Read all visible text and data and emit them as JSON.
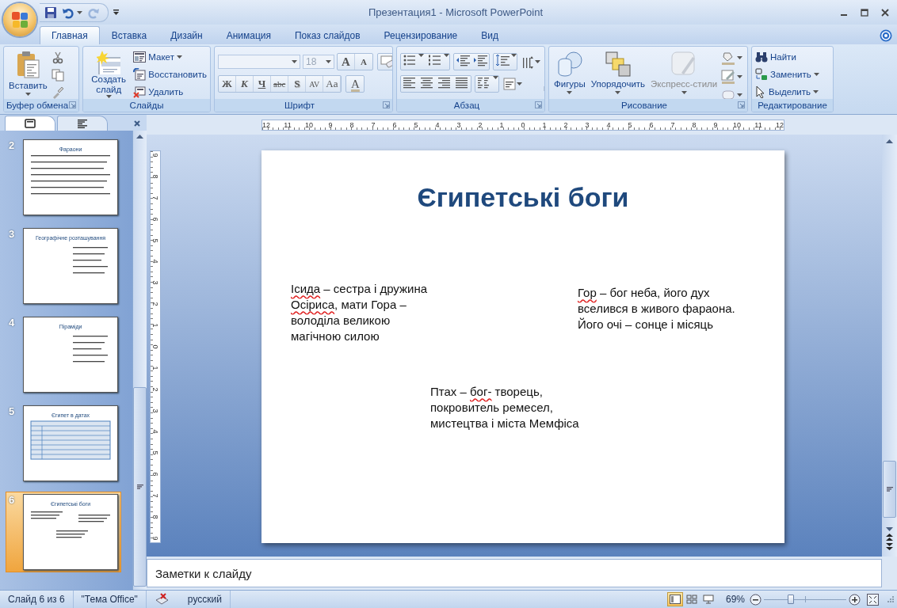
{
  "window": {
    "title": "Презентация1 - Microsoft PowerPoint"
  },
  "quick_access": [
    {
      "kind": "save",
      "disabled": false
    },
    {
      "kind": "undo",
      "disabled": false
    },
    {
      "kind": "redo",
      "disabled": true
    }
  ],
  "tabs": [
    {
      "label": "Главная",
      "selected": true
    },
    {
      "label": "Вставка",
      "selected": false
    },
    {
      "label": "Дизайн",
      "selected": false
    },
    {
      "label": "Анимация",
      "selected": false
    },
    {
      "label": "Показ слайдов",
      "selected": false
    },
    {
      "label": "Рецензирование",
      "selected": false
    },
    {
      "label": "Вид",
      "selected": false
    }
  ],
  "ribbon": {
    "groups": [
      {
        "kind": "clipboard",
        "label": "Буфер обмена",
        "paste": "Вставить"
      },
      {
        "kind": "slides",
        "label": "Слайды",
        "new_slide": "Создать слайд",
        "items": [
          {
            "kind": "layout",
            "label": "Макет",
            "dropdown": true
          },
          {
            "kind": "reset",
            "label": "Восстановить",
            "dropdown": false
          },
          {
            "kind": "delete",
            "label": "Удалить",
            "dropdown": false
          }
        ]
      },
      {
        "kind": "font",
        "label": "Шрифт",
        "font_size": {
          "value": "18",
          "disabled": true
        },
        "grow": "A",
        "shrink": "A",
        "format_buttons": [
          {
            "kind": "bold",
            "label": "Ж"
          },
          {
            "kind": "italic",
            "label": "К"
          },
          {
            "kind": "underline",
            "label": "Ч"
          },
          {
            "kind": "strike",
            "label": "abc"
          },
          {
            "kind": "shadow",
            "label": "S"
          },
          {
            "kind": "spacing",
            "label": "AV"
          },
          {
            "kind": "case",
            "label": "Aa"
          }
        ],
        "color_button": "A"
      },
      {
        "kind": "paragraph",
        "label": "Абзац"
      },
      {
        "kind": "drawing",
        "label": "Рисование",
        "buttons": [
          {
            "kind": "shapes",
            "label": "Фигуры",
            "disabled": false
          },
          {
            "kind": "arrange",
            "label": "Упорядочить",
            "disabled": false
          },
          {
            "kind": "quick_styles",
            "label": "Экспресс-стили",
            "disabled": true
          }
        ]
      },
      {
        "kind": "editing",
        "label": "Редактирование",
        "items": [
          {
            "kind": "find",
            "label": "Найти",
            "dropdown": false
          },
          {
            "kind": "replace",
            "label": "Заменить",
            "dropdown": true
          },
          {
            "kind": "select",
            "label": "Выделить",
            "dropdown": true
          }
        ]
      }
    ]
  },
  "slide_panel": {
    "slides": [
      {
        "number": "2",
        "title": "Фараони",
        "kind": "bullets",
        "selected": false
      },
      {
        "number": "3",
        "title": "Географічне розташування",
        "kind": "bullets_right",
        "selected": false
      },
      {
        "number": "4",
        "title": "Піраміди",
        "kind": "bullets_right",
        "selected": false
      },
      {
        "number": "5",
        "title": "Єгипет в датах",
        "kind": "table",
        "selected": false
      },
      {
        "number": "6",
        "title": "Єгипетські боги",
        "kind": "text_boxes",
        "selected": true
      }
    ]
  },
  "ruler": {
    "horizontal": [
      "12",
      "11",
      "10",
      "9",
      "8",
      "7",
      "6",
      "5",
      "4",
      "3",
      "2",
      "1",
      "0",
      "1",
      "2",
      "3",
      "4",
      "5",
      "6",
      "7",
      "8",
      "9",
      "10",
      "11",
      "12"
    ],
    "vertical": [
      "9",
      "8",
      "7",
      "6",
      "5",
      "4",
      "3",
      "2",
      "1",
      "0",
      "1",
      "2",
      "3",
      "4",
      "5",
      "6",
      "7",
      "8",
      "9"
    ]
  },
  "slide": {
    "title": "Єгипетські боги",
    "text_boxes": [
      {
        "segments": [
          {
            "text": "Ісида",
            "misspelled": true
          },
          {
            "text": " – сестра і дружина ",
            "misspelled": false
          },
          {
            "text": "Осіриса",
            "misspelled": true
          },
          {
            "text": ", мати Гора – володіла великою магічною силою",
            "misspelled": false
          }
        ]
      },
      {
        "segments": [
          {
            "text": "Гор",
            "misspelled": true
          },
          {
            "text": " – бог неба, його дух вселився в живого фараона. Його очі – сонце і місяць",
            "misspelled": false
          }
        ]
      },
      {
        "segments": [
          {
            "text": "Птах – ",
            "misspelled": false
          },
          {
            "text": "бог-",
            "misspelled": true
          },
          {
            "text": " творець, покровитель ремесел, мистецтва і міста Мемфіса",
            "misspelled": false
          }
        ]
      }
    ]
  },
  "notes": {
    "placeholder": "Заметки к слайду"
  },
  "status": {
    "slide": "Слайд 6 из 6",
    "theme": "\"Тема Office\"",
    "language": "русский",
    "views": [
      {
        "kind": "normal",
        "selected": true
      },
      {
        "kind": "sorter",
        "selected": false
      },
      {
        "kind": "show",
        "selected": false
      }
    ],
    "zoom": {
      "reading": "69%",
      "level": 0.33
    }
  }
}
